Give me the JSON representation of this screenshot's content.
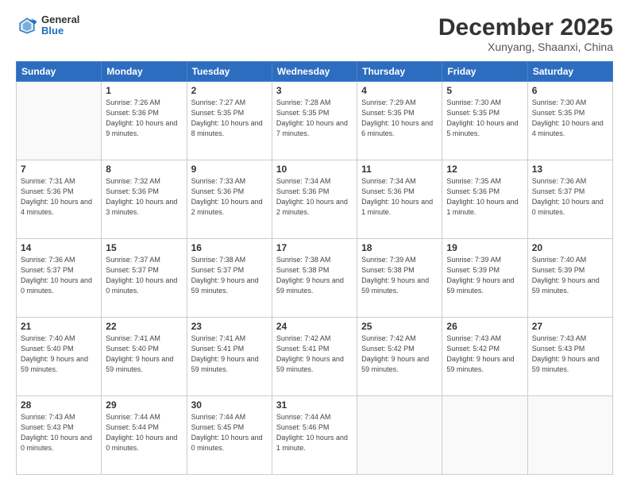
{
  "header": {
    "logo": {
      "general": "General",
      "blue": "Blue"
    },
    "month": "December 2025",
    "location": "Xunyang, Shaanxi, China"
  },
  "weekdays": [
    "Sunday",
    "Monday",
    "Tuesday",
    "Wednesday",
    "Thursday",
    "Friday",
    "Saturday"
  ],
  "weeks": [
    [
      {
        "day": "",
        "info": ""
      },
      {
        "day": "1",
        "info": "Sunrise: 7:26 AM\nSunset: 5:36 PM\nDaylight: 10 hours\nand 9 minutes."
      },
      {
        "day": "2",
        "info": "Sunrise: 7:27 AM\nSunset: 5:35 PM\nDaylight: 10 hours\nand 8 minutes."
      },
      {
        "day": "3",
        "info": "Sunrise: 7:28 AM\nSunset: 5:35 PM\nDaylight: 10 hours\nand 7 minutes."
      },
      {
        "day": "4",
        "info": "Sunrise: 7:29 AM\nSunset: 5:35 PM\nDaylight: 10 hours\nand 6 minutes."
      },
      {
        "day": "5",
        "info": "Sunrise: 7:30 AM\nSunset: 5:35 PM\nDaylight: 10 hours\nand 5 minutes."
      },
      {
        "day": "6",
        "info": "Sunrise: 7:30 AM\nSunset: 5:35 PM\nDaylight: 10 hours\nand 4 minutes."
      }
    ],
    [
      {
        "day": "7",
        "info": "Sunrise: 7:31 AM\nSunset: 5:36 PM\nDaylight: 10 hours\nand 4 minutes."
      },
      {
        "day": "8",
        "info": "Sunrise: 7:32 AM\nSunset: 5:36 PM\nDaylight: 10 hours\nand 3 minutes."
      },
      {
        "day": "9",
        "info": "Sunrise: 7:33 AM\nSunset: 5:36 PM\nDaylight: 10 hours\nand 2 minutes."
      },
      {
        "day": "10",
        "info": "Sunrise: 7:34 AM\nSunset: 5:36 PM\nDaylight: 10 hours\nand 2 minutes."
      },
      {
        "day": "11",
        "info": "Sunrise: 7:34 AM\nSunset: 5:36 PM\nDaylight: 10 hours\nand 1 minute."
      },
      {
        "day": "12",
        "info": "Sunrise: 7:35 AM\nSunset: 5:36 PM\nDaylight: 10 hours\nand 1 minute."
      },
      {
        "day": "13",
        "info": "Sunrise: 7:36 AM\nSunset: 5:37 PM\nDaylight: 10 hours\nand 0 minutes."
      }
    ],
    [
      {
        "day": "14",
        "info": "Sunrise: 7:36 AM\nSunset: 5:37 PM\nDaylight: 10 hours\nand 0 minutes."
      },
      {
        "day": "15",
        "info": "Sunrise: 7:37 AM\nSunset: 5:37 PM\nDaylight: 10 hours\nand 0 minutes."
      },
      {
        "day": "16",
        "info": "Sunrise: 7:38 AM\nSunset: 5:37 PM\nDaylight: 9 hours\nand 59 minutes."
      },
      {
        "day": "17",
        "info": "Sunrise: 7:38 AM\nSunset: 5:38 PM\nDaylight: 9 hours\nand 59 minutes."
      },
      {
        "day": "18",
        "info": "Sunrise: 7:39 AM\nSunset: 5:38 PM\nDaylight: 9 hours\nand 59 minutes."
      },
      {
        "day": "19",
        "info": "Sunrise: 7:39 AM\nSunset: 5:39 PM\nDaylight: 9 hours\nand 59 minutes."
      },
      {
        "day": "20",
        "info": "Sunrise: 7:40 AM\nSunset: 5:39 PM\nDaylight: 9 hours\nand 59 minutes."
      }
    ],
    [
      {
        "day": "21",
        "info": "Sunrise: 7:40 AM\nSunset: 5:40 PM\nDaylight: 9 hours\nand 59 minutes."
      },
      {
        "day": "22",
        "info": "Sunrise: 7:41 AM\nSunset: 5:40 PM\nDaylight: 9 hours\nand 59 minutes."
      },
      {
        "day": "23",
        "info": "Sunrise: 7:41 AM\nSunset: 5:41 PM\nDaylight: 9 hours\nand 59 minutes."
      },
      {
        "day": "24",
        "info": "Sunrise: 7:42 AM\nSunset: 5:41 PM\nDaylight: 9 hours\nand 59 minutes."
      },
      {
        "day": "25",
        "info": "Sunrise: 7:42 AM\nSunset: 5:42 PM\nDaylight: 9 hours\nand 59 minutes."
      },
      {
        "day": "26",
        "info": "Sunrise: 7:43 AM\nSunset: 5:42 PM\nDaylight: 9 hours\nand 59 minutes."
      },
      {
        "day": "27",
        "info": "Sunrise: 7:43 AM\nSunset: 5:43 PM\nDaylight: 9 hours\nand 59 minutes."
      }
    ],
    [
      {
        "day": "28",
        "info": "Sunrise: 7:43 AM\nSunset: 5:43 PM\nDaylight: 10 hours\nand 0 minutes."
      },
      {
        "day": "29",
        "info": "Sunrise: 7:44 AM\nSunset: 5:44 PM\nDaylight: 10 hours\nand 0 minutes."
      },
      {
        "day": "30",
        "info": "Sunrise: 7:44 AM\nSunset: 5:45 PM\nDaylight: 10 hours\nand 0 minutes."
      },
      {
        "day": "31",
        "info": "Sunrise: 7:44 AM\nSunset: 5:46 PM\nDaylight: 10 hours\nand 1 minute."
      },
      {
        "day": "",
        "info": ""
      },
      {
        "day": "",
        "info": ""
      },
      {
        "day": "",
        "info": ""
      }
    ]
  ]
}
